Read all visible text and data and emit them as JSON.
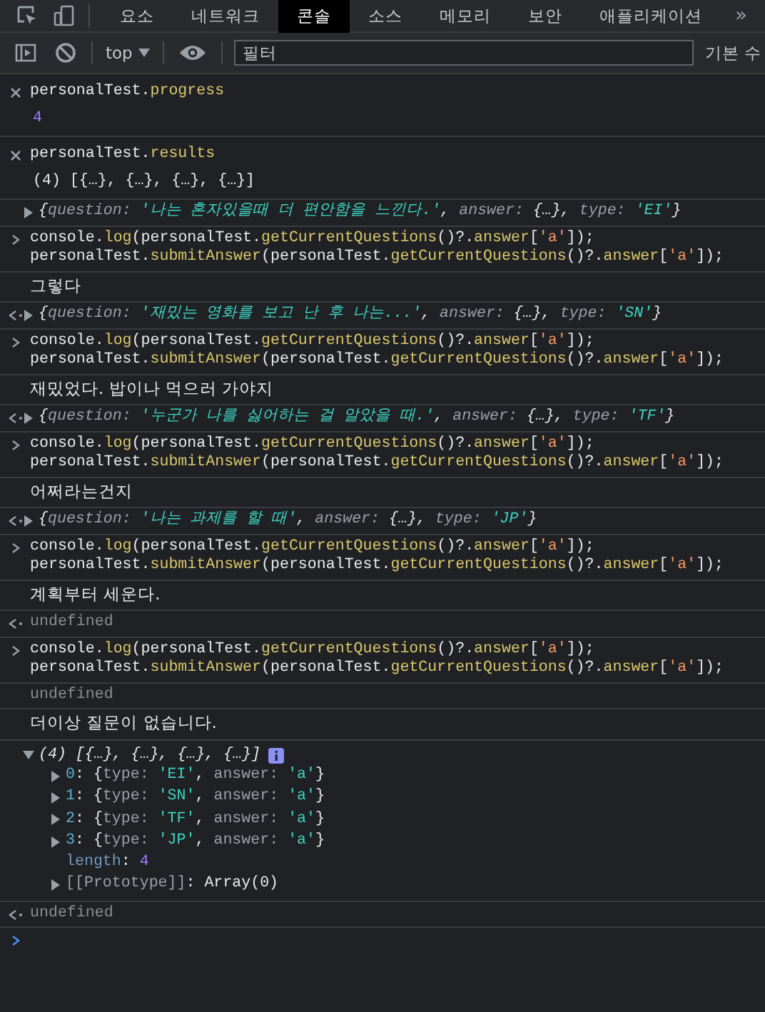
{
  "tabs": [
    {
      "label": "요소",
      "selected": false
    },
    {
      "label": "네트워크",
      "selected": false
    },
    {
      "label": "콘솔",
      "selected": true
    },
    {
      "label": "소스",
      "selected": false
    },
    {
      "label": "메모리",
      "selected": false
    },
    {
      "label": "보안",
      "selected": false
    },
    {
      "label": "애플리케이션",
      "selected": false
    }
  ],
  "tabs_more": "»",
  "toolbar": {
    "context": "top",
    "filter": {
      "placeholder": "필터"
    },
    "levels": "기본 수"
  },
  "entries": [
    {
      "kind": "evaluation",
      "lines": [
        [
          {
            "text": "personalTest.",
            "kind": "plain"
          },
          {
            "text": "progress",
            "kind": "fn"
          }
        ],
        [
          {
            "text": "4",
            "kind": "num"
          }
        ]
      ]
    },
    {
      "kind": "evaluation",
      "lines": [
        [
          {
            "text": "personalTest.",
            "kind": "plain"
          },
          {
            "text": "results",
            "kind": "fn"
          }
        ],
        [
          {
            "text": "(4) [{…}, {…}, {…}, {…}]",
            "kind": "plain"
          }
        ]
      ]
    },
    {
      "kind": "object",
      "expanded": false,
      "lines": [
        [
          {
            "text": "{",
            "kind": "plain"
          },
          {
            "text": "question: ",
            "kind": "key"
          },
          {
            "text": "'나는 혼자있을때 더 편안함을 느낀다.'",
            "kind": "qstr"
          },
          {
            "text": ", ",
            "kind": "plain"
          },
          {
            "text": "answer: ",
            "kind": "key"
          },
          {
            "text": "{…}",
            "kind": "plain"
          },
          {
            "text": ", ",
            "kind": "plain"
          },
          {
            "text": "type: ",
            "kind": "key"
          },
          {
            "text": "'EI'",
            "kind": "qstr"
          },
          {
            "text": "}",
            "kind": "plain"
          }
        ]
      ]
    },
    {
      "kind": "command",
      "lines": [
        [
          {
            "text": "console.",
            "kind": "plain"
          },
          {
            "text": "log",
            "kind": "fn"
          },
          {
            "text": "(personalTest.",
            "kind": "plain"
          },
          {
            "text": "getCurrentQuestions",
            "kind": "fn"
          },
          {
            "text": "()?.",
            "kind": "plain"
          },
          {
            "text": "answer",
            "kind": "fn"
          },
          {
            "text": "[",
            "kind": "plain"
          },
          {
            "text": "'a'",
            "kind": "str"
          },
          {
            "text": "]);",
            "kind": "plain"
          }
        ],
        [
          {
            "text": "personalTest.",
            "kind": "plain"
          },
          {
            "text": "submitAnswer",
            "kind": "fn"
          },
          {
            "text": "(personalTest.",
            "kind": "plain"
          },
          {
            "text": "getCurrentQuestions",
            "kind": "fn"
          },
          {
            "text": "()?.",
            "kind": "plain"
          },
          {
            "text": "answer",
            "kind": "fn"
          },
          {
            "text": "[",
            "kind": "plain"
          },
          {
            "text": "'a'",
            "kind": "str"
          },
          {
            "text": "]);",
            "kind": "plain"
          }
        ]
      ]
    },
    {
      "kind": "log",
      "lines": [
        [
          {
            "text": "그렇다",
            "kind": "plain"
          }
        ]
      ]
    },
    {
      "kind": "result",
      "expanded": false,
      "lines": [
        [
          {
            "text": "{",
            "kind": "plain"
          },
          {
            "text": "question: ",
            "kind": "key"
          },
          {
            "text": "'재밌는 영화를 보고 난 후 나는...'",
            "kind": "qstr"
          },
          {
            "text": ", ",
            "kind": "plain"
          },
          {
            "text": "answer: ",
            "kind": "key"
          },
          {
            "text": "{…}",
            "kind": "plain"
          },
          {
            "text": ", ",
            "kind": "plain"
          },
          {
            "text": "type: ",
            "kind": "key"
          },
          {
            "text": "'SN'",
            "kind": "qstr"
          },
          {
            "text": "}",
            "kind": "plain"
          }
        ]
      ]
    },
    {
      "kind": "command",
      "lines": [
        [
          {
            "text": "console.",
            "kind": "plain"
          },
          {
            "text": "log",
            "kind": "fn"
          },
          {
            "text": "(personalTest.",
            "kind": "plain"
          },
          {
            "text": "getCurrentQuestions",
            "kind": "fn"
          },
          {
            "text": "()?.",
            "kind": "plain"
          },
          {
            "text": "answer",
            "kind": "fn"
          },
          {
            "text": "[",
            "kind": "plain"
          },
          {
            "text": "'a'",
            "kind": "str"
          },
          {
            "text": "]);",
            "kind": "plain"
          }
        ],
        [
          {
            "text": "personalTest.",
            "kind": "plain"
          },
          {
            "text": "submitAnswer",
            "kind": "fn"
          },
          {
            "text": "(personalTest.",
            "kind": "plain"
          },
          {
            "text": "getCurrentQuestions",
            "kind": "fn"
          },
          {
            "text": "()?.",
            "kind": "plain"
          },
          {
            "text": "answer",
            "kind": "fn"
          },
          {
            "text": "[",
            "kind": "plain"
          },
          {
            "text": "'a'",
            "kind": "str"
          },
          {
            "text": "]);",
            "kind": "plain"
          }
        ]
      ]
    },
    {
      "kind": "log",
      "lines": [
        [
          {
            "text": "재밌었다. 밥이나 먹으러 가야지",
            "kind": "plain"
          }
        ]
      ]
    },
    {
      "kind": "result",
      "expanded": false,
      "lines": [
        [
          {
            "text": "{",
            "kind": "plain"
          },
          {
            "text": "question: ",
            "kind": "key"
          },
          {
            "text": "'누군가 나를 싫어하는 걸 알았을 때.'",
            "kind": "qstr"
          },
          {
            "text": ", ",
            "kind": "plain"
          },
          {
            "text": "answer: ",
            "kind": "key"
          },
          {
            "text": "{…}",
            "kind": "plain"
          },
          {
            "text": ", ",
            "kind": "plain"
          },
          {
            "text": "type: ",
            "kind": "key"
          },
          {
            "text": "'TF'",
            "kind": "qstr"
          },
          {
            "text": "}",
            "kind": "plain"
          }
        ]
      ]
    },
    {
      "kind": "command",
      "lines": [
        [
          {
            "text": "console.",
            "kind": "plain"
          },
          {
            "text": "log",
            "kind": "fn"
          },
          {
            "text": "(personalTest.",
            "kind": "plain"
          },
          {
            "text": "getCurrentQuestions",
            "kind": "fn"
          },
          {
            "text": "()?.",
            "kind": "plain"
          },
          {
            "text": "answer",
            "kind": "fn"
          },
          {
            "text": "[",
            "kind": "plain"
          },
          {
            "text": "'a'",
            "kind": "str"
          },
          {
            "text": "]);",
            "kind": "plain"
          }
        ],
        [
          {
            "text": "personalTest.",
            "kind": "plain"
          },
          {
            "text": "submitAnswer",
            "kind": "fn"
          },
          {
            "text": "(personalTest.",
            "kind": "plain"
          },
          {
            "text": "getCurrentQuestions",
            "kind": "fn"
          },
          {
            "text": "()?.",
            "kind": "plain"
          },
          {
            "text": "answer",
            "kind": "fn"
          },
          {
            "text": "[",
            "kind": "plain"
          },
          {
            "text": "'a'",
            "kind": "str"
          },
          {
            "text": "]);",
            "kind": "plain"
          }
        ]
      ]
    },
    {
      "kind": "log",
      "lines": [
        [
          {
            "text": "어쩌라는건지",
            "kind": "plain"
          }
        ]
      ]
    },
    {
      "kind": "result",
      "expanded": false,
      "lines": [
        [
          {
            "text": "{",
            "kind": "plain"
          },
          {
            "text": "question: ",
            "kind": "key"
          },
          {
            "text": "'나는 과제를 할 때'",
            "kind": "qstr"
          },
          {
            "text": ", ",
            "kind": "plain"
          },
          {
            "text": "answer: ",
            "kind": "key"
          },
          {
            "text": "{…}",
            "kind": "plain"
          },
          {
            "text": ", ",
            "kind": "plain"
          },
          {
            "text": "type: ",
            "kind": "key"
          },
          {
            "text": "'JP'",
            "kind": "qstr"
          },
          {
            "text": "}",
            "kind": "plain"
          }
        ]
      ]
    },
    {
      "kind": "command",
      "lines": [
        [
          {
            "text": "console.",
            "kind": "plain"
          },
          {
            "text": "log",
            "kind": "fn"
          },
          {
            "text": "(personalTest.",
            "kind": "plain"
          },
          {
            "text": "getCurrentQuestions",
            "kind": "fn"
          },
          {
            "text": "()?.",
            "kind": "plain"
          },
          {
            "text": "answer",
            "kind": "fn"
          },
          {
            "text": "[",
            "kind": "plain"
          },
          {
            "text": "'a'",
            "kind": "str"
          },
          {
            "text": "]);",
            "kind": "plain"
          }
        ],
        [
          {
            "text": "personalTest.",
            "kind": "plain"
          },
          {
            "text": "submitAnswer",
            "kind": "fn"
          },
          {
            "text": "(personalTest.",
            "kind": "plain"
          },
          {
            "text": "getCurrentQuestions",
            "kind": "fn"
          },
          {
            "text": "()?.",
            "kind": "plain"
          },
          {
            "text": "answer",
            "kind": "fn"
          },
          {
            "text": "[",
            "kind": "plain"
          },
          {
            "text": "'a'",
            "kind": "str"
          },
          {
            "text": "]);",
            "kind": "plain"
          }
        ]
      ]
    },
    {
      "kind": "log",
      "lines": [
        [
          {
            "text": "계획부터 세운다.",
            "kind": "plain"
          }
        ]
      ]
    },
    {
      "kind": "returned",
      "lines": [
        [
          {
            "text": "undefined",
            "kind": "undef"
          }
        ]
      ]
    },
    {
      "kind": "command",
      "lines": [
        [
          {
            "text": "console.",
            "kind": "plain"
          },
          {
            "text": "log",
            "kind": "fn"
          },
          {
            "text": "(personalTest.",
            "kind": "plain"
          },
          {
            "text": "getCurrentQuestions",
            "kind": "fn"
          },
          {
            "text": "()?.",
            "kind": "plain"
          },
          {
            "text": "answer",
            "kind": "fn"
          },
          {
            "text": "[",
            "kind": "plain"
          },
          {
            "text": "'a'",
            "kind": "str"
          },
          {
            "text": "]);",
            "kind": "plain"
          }
        ],
        [
          {
            "text": "personalTest.",
            "kind": "plain"
          },
          {
            "text": "submitAnswer",
            "kind": "fn"
          },
          {
            "text": "(personalTest.",
            "kind": "plain"
          },
          {
            "text": "getCurrentQuestions",
            "kind": "fn"
          },
          {
            "text": "()?.",
            "kind": "plain"
          },
          {
            "text": "answer",
            "kind": "fn"
          },
          {
            "text": "[",
            "kind": "plain"
          },
          {
            "text": "'a'",
            "kind": "str"
          },
          {
            "text": "]);",
            "kind": "plain"
          }
        ]
      ]
    },
    {
      "kind": "value",
      "lines": [
        [
          {
            "text": "undefined",
            "kind": "undef"
          }
        ]
      ]
    },
    {
      "kind": "log",
      "lines": [
        [
          {
            "text": "더이상 질문이 없습니다.",
            "kind": "plain"
          }
        ]
      ]
    },
    {
      "kind": "tree",
      "header": {
        "expanded": true,
        "segs": [
          {
            "text": "(4) [{…}, {…}, {…}, {…}]",
            "kind": "plain"
          }
        ]
      },
      "children": [
        {
          "kind": "node",
          "expanded": false,
          "segs": [
            {
              "text": "0",
              "kind": "idx"
            },
            {
              "text": ": {",
              "kind": "plain"
            },
            {
              "text": "type: ",
              "kind": "key"
            },
            {
              "text": "'EI'",
              "kind": "qstr"
            },
            {
              "text": ", ",
              "kind": "plain"
            },
            {
              "text": "answer: ",
              "kind": "key"
            },
            {
              "text": "'a'",
              "kind": "qstr"
            },
            {
              "text": "}",
              "kind": "plain"
            }
          ]
        },
        {
          "kind": "node",
          "expanded": false,
          "segs": [
            {
              "text": "1",
              "kind": "idx"
            },
            {
              "text": ": {",
              "kind": "plain"
            },
            {
              "text": "type: ",
              "kind": "key"
            },
            {
              "text": "'SN'",
              "kind": "qstr"
            },
            {
              "text": ", ",
              "kind": "plain"
            },
            {
              "text": "answer: ",
              "kind": "key"
            },
            {
              "text": "'a'",
              "kind": "qstr"
            },
            {
              "text": "}",
              "kind": "plain"
            }
          ]
        },
        {
          "kind": "node",
          "expanded": false,
          "segs": [
            {
              "text": "2",
              "kind": "idx"
            },
            {
              "text": ": {",
              "kind": "plain"
            },
            {
              "text": "type: ",
              "kind": "key"
            },
            {
              "text": "'TF'",
              "kind": "qstr"
            },
            {
              "text": ", ",
              "kind": "plain"
            },
            {
              "text": "answer: ",
              "kind": "key"
            },
            {
              "text": "'a'",
              "kind": "qstr"
            },
            {
              "text": "}",
              "kind": "plain"
            }
          ]
        },
        {
          "kind": "node",
          "expanded": false,
          "segs": [
            {
              "text": "3",
              "kind": "idx"
            },
            {
              "text": ": {",
              "kind": "plain"
            },
            {
              "text": "type: ",
              "kind": "key"
            },
            {
              "text": "'JP'",
              "kind": "qstr"
            },
            {
              "text": ", ",
              "kind": "plain"
            },
            {
              "text": "answer: ",
              "kind": "key"
            },
            {
              "text": "'a'",
              "kind": "qstr"
            },
            {
              "text": "}",
              "kind": "plain"
            }
          ]
        },
        {
          "kind": "leaf",
          "segs": [
            {
              "text": "length",
              "kind": "lkey"
            },
            {
              "text": ": ",
              "kind": "plain"
            },
            {
              "text": "4",
              "kind": "num"
            }
          ]
        },
        {
          "kind": "node",
          "expanded": false,
          "segs": [
            {
              "text": "[[Prototype]]",
              "kind": "key"
            },
            {
              "text": ": Array(0)",
              "kind": "plain"
            }
          ]
        }
      ]
    },
    {
      "kind": "returned",
      "lines": [
        [
          {
            "text": "undefined",
            "kind": "undef"
          }
        ]
      ]
    }
  ]
}
